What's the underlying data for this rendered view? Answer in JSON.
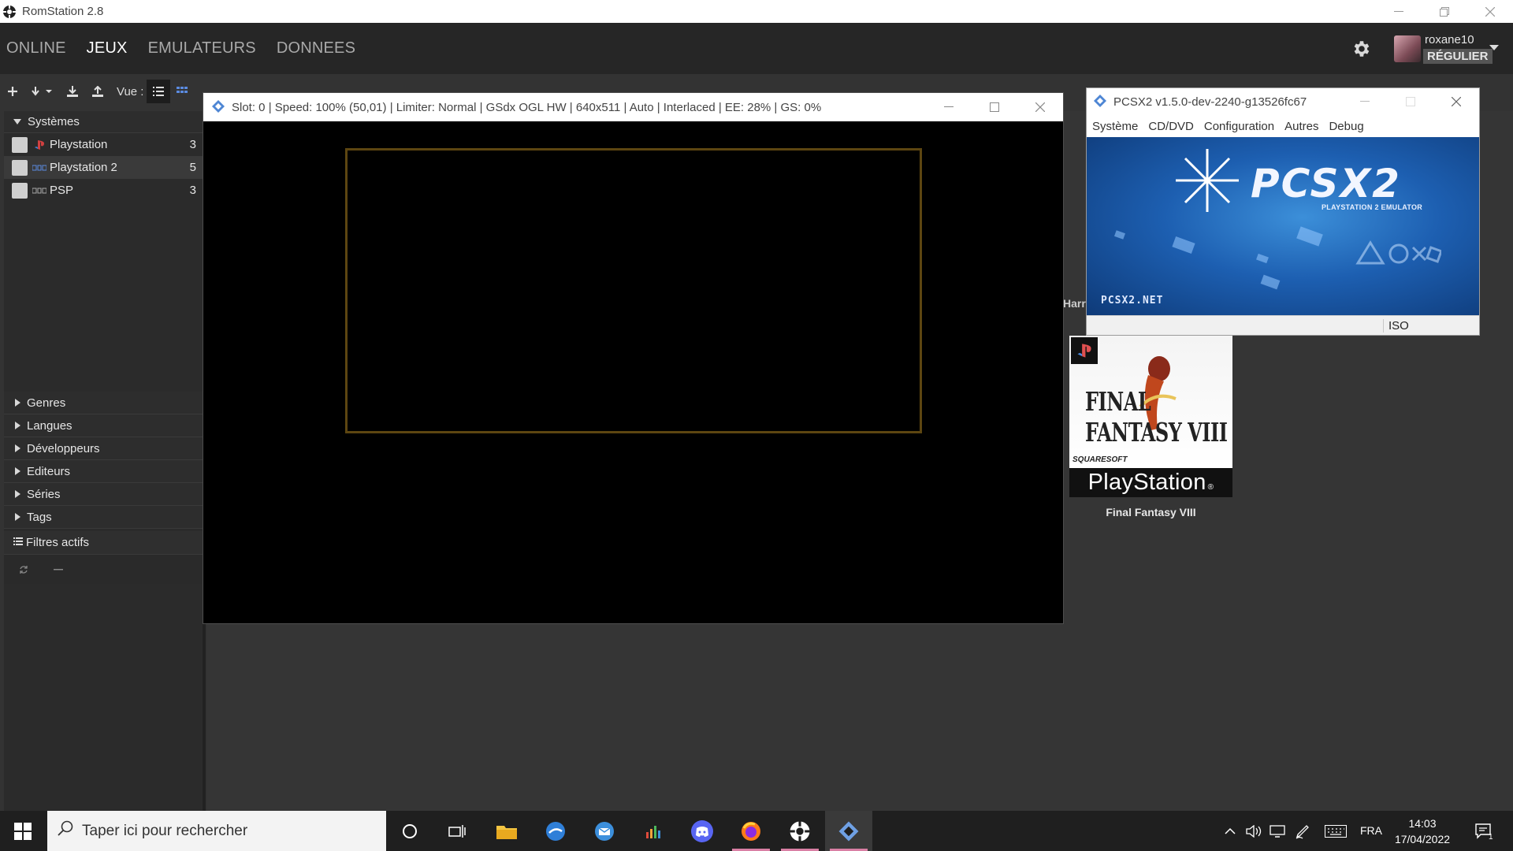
{
  "window": {
    "title": "RomStation 2.8"
  },
  "nav": {
    "tabs": [
      {
        "label": "ONLINE",
        "active": false
      },
      {
        "label": "JEUX",
        "active": true
      },
      {
        "label": "EMULATEURS",
        "active": false
      },
      {
        "label": "DONNEES",
        "active": false
      }
    ],
    "user": {
      "name": "roxane10",
      "role": "RÉGULIER"
    }
  },
  "toolbar": {
    "view_label": "Vue :"
  },
  "sidebar": {
    "systems_header": "Systèmes",
    "systems": [
      {
        "name": "Playstation",
        "count": "3",
        "icon": "playstation-logo-icon"
      },
      {
        "name": "Playstation 2",
        "count": "5",
        "icon": "ps2-logo-icon"
      },
      {
        "name": "PSP",
        "count": "3",
        "icon": "psp-logo-icon"
      }
    ],
    "sections": [
      "Genres",
      "Langues",
      "Développeurs",
      "Editeurs",
      "Séries",
      "Tags"
    ],
    "filters_label": "Filtres actifs"
  },
  "content": {
    "partial_title": "Harr",
    "game": {
      "title": "Final Fantasy VIII",
      "cover_brand": "PlayStation",
      "cover_logo": "FINAL FANTASY VIII",
      "cover_publisher": "SQUARESOFT"
    }
  },
  "gs_window": {
    "title": "Slot: 0 | Speed: 100% (50,01) | Limiter: Normal | GSdx OGL HW | 640x511 | Auto | Interlaced | EE:  28% | GS:   0%"
  },
  "pcsx2_window": {
    "title": "PCSX2 v1.5.0-dev-2240-g13526fc67",
    "menu": [
      "Système",
      "CD/DVD",
      "Configuration",
      "Autres",
      "Debug"
    ],
    "banner_logo": "PCSX2",
    "banner_subtitle": "PLAYSTATION 2 EMULATOR",
    "banner_site": "PCSX2.NET",
    "status": "ISO"
  },
  "taskbar": {
    "search_placeholder": "Taper ici pour rechercher",
    "language": "FRA",
    "time": "14:03",
    "date": "17/04/2022"
  },
  "colors": {
    "accent_running": "#d97fa4",
    "gs_frame": "#5d4611",
    "pcsx2_blue": "#1d5fb1"
  }
}
